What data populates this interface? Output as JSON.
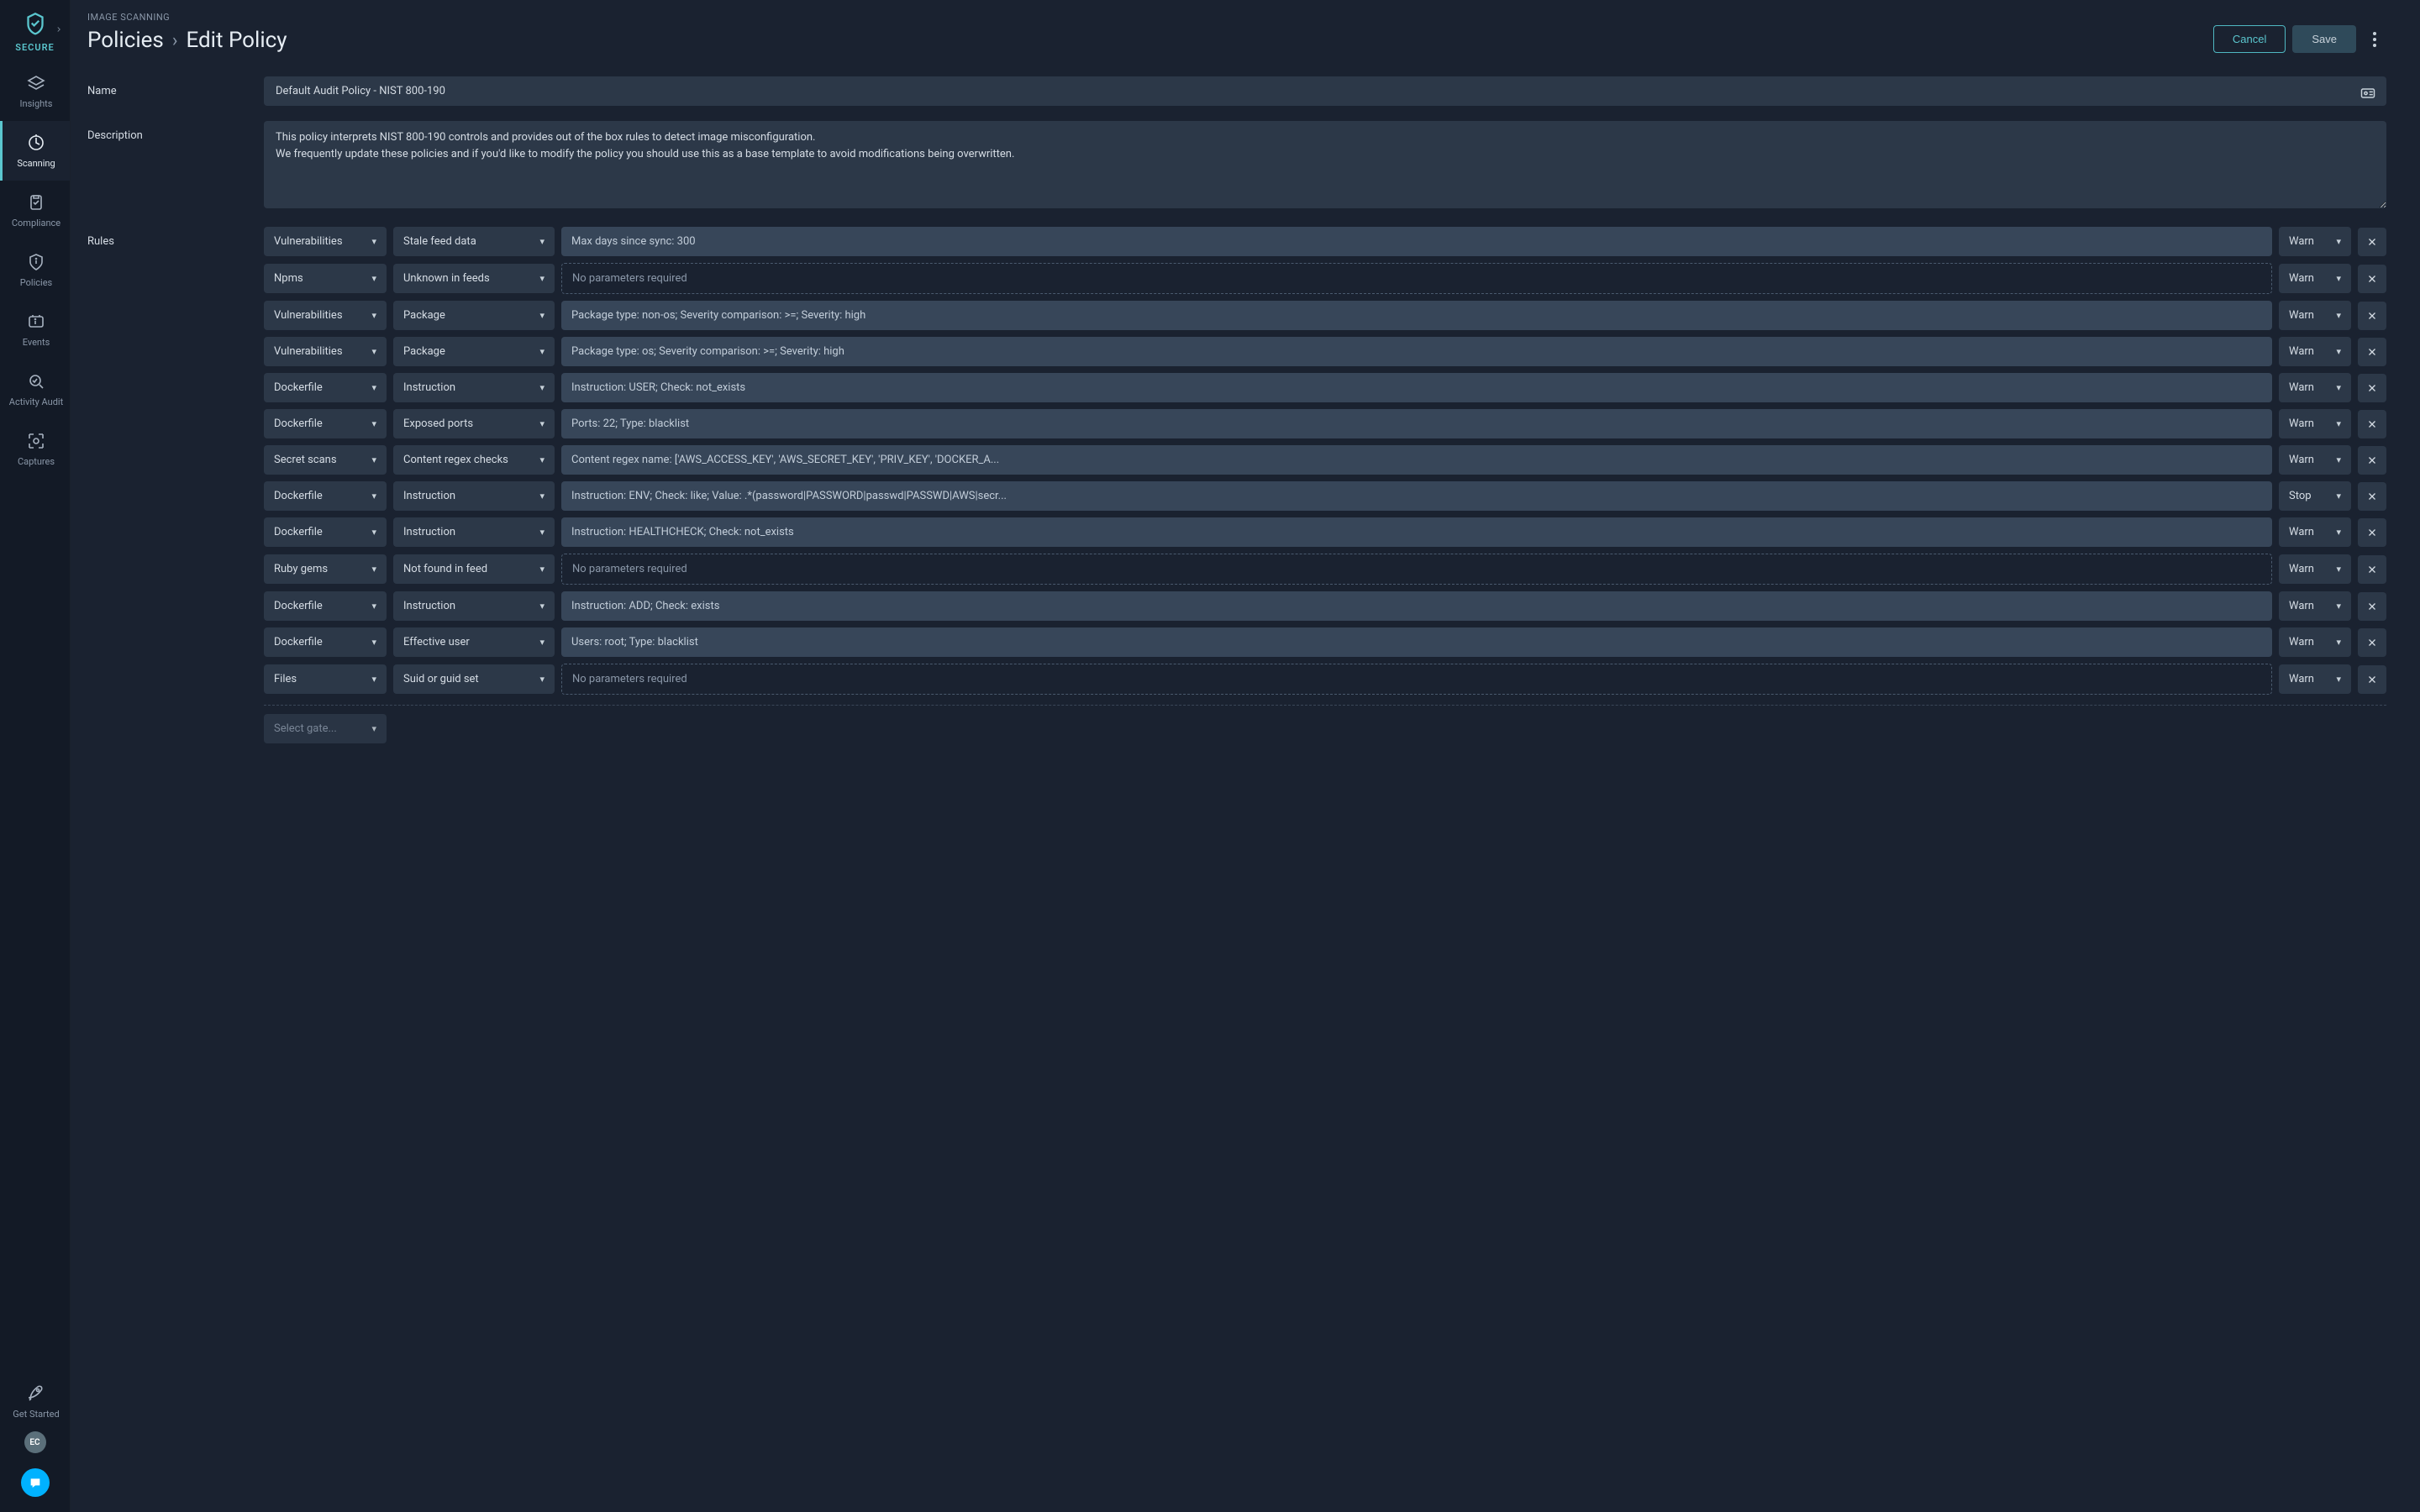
{
  "sidebar": {
    "brand": "SECURE",
    "items": [
      {
        "id": "insights",
        "label": "Insights"
      },
      {
        "id": "scanning",
        "label": "Scanning",
        "active": true
      },
      {
        "id": "compliance",
        "label": "Compliance"
      },
      {
        "id": "policies",
        "label": "Policies"
      },
      {
        "id": "events",
        "label": "Events"
      },
      {
        "id": "activity",
        "label": "Activity Audit"
      },
      {
        "id": "captures",
        "label": "Captures"
      }
    ],
    "get_started": "Get Started",
    "avatar": "EC"
  },
  "header": {
    "overline": "IMAGE SCANNING",
    "breadcrumb_root": "Policies",
    "breadcrumb_current": "Edit Policy",
    "cancel": "Cancel",
    "save": "Save"
  },
  "form": {
    "name_label": "Name",
    "name_value": "Default Audit Policy - NIST 800-190",
    "description_label": "Description",
    "description_value": "This policy interprets NIST 800-190 controls and provides out of the box rules to detect image misconfiguration.\nWe frequently update these policies and if you'd like to modify the policy you should use this as a base template to avoid modifications being overwritten.",
    "rules_label": "Rules",
    "new_gate_placeholder": "Select gate...",
    "no_params_text": "No parameters required"
  },
  "rules": [
    {
      "gate": "Vulnerabilities",
      "trigger": "Stale feed data",
      "params": "Max days since sync: 300",
      "action": "Warn"
    },
    {
      "gate": "Npms",
      "trigger": "Unknown in feeds",
      "params": "",
      "action": "Warn"
    },
    {
      "gate": "Vulnerabilities",
      "trigger": "Package",
      "params": "Package type: non-os; Severity comparison: >=; Severity: high",
      "action": "Warn"
    },
    {
      "gate": "Vulnerabilities",
      "trigger": "Package",
      "params": "Package type: os; Severity comparison: >=; Severity: high",
      "action": "Warn"
    },
    {
      "gate": "Dockerfile",
      "trigger": "Instruction",
      "params": "Instruction: USER; Check: not_exists",
      "action": "Warn"
    },
    {
      "gate": "Dockerfile",
      "trigger": "Exposed ports",
      "params": "Ports: 22; Type: blacklist",
      "action": "Warn"
    },
    {
      "gate": "Secret scans",
      "trigger": "Content regex checks",
      "params": "Content regex name: ['AWS_ACCESS_KEY', 'AWS_SECRET_KEY', 'PRIV_KEY', 'DOCKER_A...",
      "action": "Warn"
    },
    {
      "gate": "Dockerfile",
      "trigger": "Instruction",
      "params": "Instruction: ENV; Check: like; Value: .*(password|PASSWORD|passwd|PASSWD|AWS|secr...",
      "action": "Stop"
    },
    {
      "gate": "Dockerfile",
      "trigger": "Instruction",
      "params": "Instruction: HEALTHCHECK; Check: not_exists",
      "action": "Warn"
    },
    {
      "gate": "Ruby gems",
      "trigger": "Not found in feed",
      "params": "",
      "action": "Warn"
    },
    {
      "gate": "Dockerfile",
      "trigger": "Instruction",
      "params": "Instruction: ADD; Check: exists",
      "action": "Warn"
    },
    {
      "gate": "Dockerfile",
      "trigger": "Effective user",
      "params": "Users: root; Type: blacklist",
      "action": "Warn"
    },
    {
      "gate": "Files",
      "trigger": "Suid or guid set",
      "params": "",
      "action": "Warn"
    }
  ]
}
